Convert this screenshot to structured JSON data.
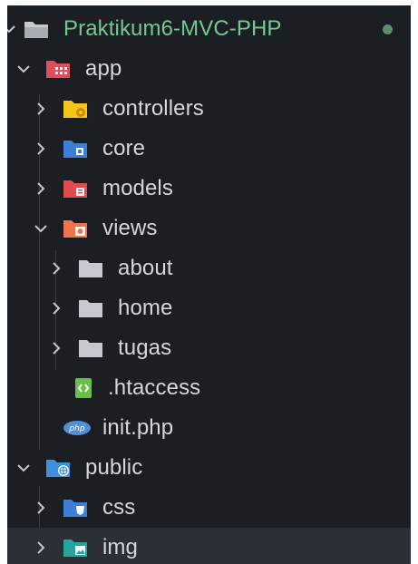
{
  "explorer": {
    "root": {
      "label": "Praktikum6-MVC-PHP",
      "color": "#73c991",
      "status_dot_color": "#5a8f69"
    },
    "items": [
      {
        "label": "app",
        "type": "folder-open",
        "icon": "app-folder-icon",
        "color": "#e34c5a",
        "depth": 1
      },
      {
        "label": "controllers",
        "type": "folder-closed",
        "icon": "controllers-folder-icon",
        "color": "#f5c518",
        "depth": 2
      },
      {
        "label": "core",
        "type": "folder-closed",
        "icon": "core-folder-icon",
        "color": "#3d7fd6",
        "depth": 2
      },
      {
        "label": "models",
        "type": "folder-closed",
        "icon": "models-folder-icon",
        "color": "#e34c4c",
        "depth": 2
      },
      {
        "label": "views",
        "type": "folder-open",
        "icon": "views-folder-icon",
        "color": "#f0744a",
        "depth": 2
      },
      {
        "label": "about",
        "type": "folder-closed",
        "icon": "folder-icon",
        "color": "#c5c8ce",
        "depth": 3
      },
      {
        "label": "home",
        "type": "folder-closed",
        "icon": "folder-icon",
        "color": "#c5c8ce",
        "depth": 3
      },
      {
        "label": "tugas",
        "type": "folder-closed",
        "icon": "folder-icon",
        "color": "#c5c8ce",
        "depth": 3
      },
      {
        "label": ".htaccess",
        "type": "file",
        "icon": "htaccess-file-icon",
        "color": "#6abf4b",
        "depth": 2
      },
      {
        "label": "init.php",
        "type": "file",
        "icon": "php-file-icon",
        "color": "#4f8fd8",
        "depth": 2
      },
      {
        "label": "public",
        "type": "folder-open",
        "icon": "public-folder-icon",
        "color": "#3d8fe0",
        "depth": 1
      },
      {
        "label": "css",
        "type": "folder-closed",
        "icon": "css-folder-icon",
        "color": "#3d7fd6",
        "depth": 2
      },
      {
        "label": "img",
        "type": "folder-closed",
        "icon": "img-folder-icon",
        "color": "#26a69a",
        "depth": 2,
        "hovered": true
      }
    ]
  }
}
